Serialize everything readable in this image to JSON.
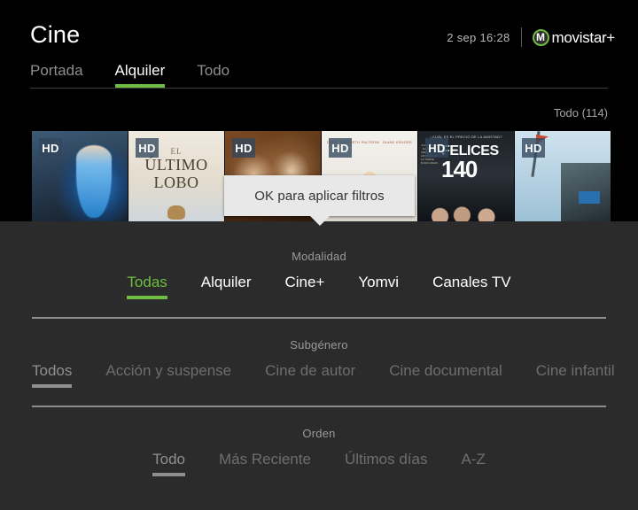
{
  "header": {
    "title": "Cine",
    "clock": "2 sep 16:28",
    "brand_mark": "M",
    "brand_text": "movistar+",
    "brand_icon": "movistar-logo-icon",
    "accent_color": "#6fbe44",
    "background_color": "#000000"
  },
  "tabs": [
    {
      "label": "Portada",
      "selected": false
    },
    {
      "label": "Alquiler",
      "selected": true
    },
    {
      "label": "Todo",
      "selected": false
    }
  ],
  "content": {
    "count_label": "Todo (114)",
    "posters": [
      {
        "badge": "HD",
        "title": "",
        "alt": "cinderella-poster"
      },
      {
        "badge": "HD",
        "title_line1": "EL",
        "title_line2": "ÚLTIMO",
        "title_line3": "LOBO",
        "alt": "el-ultimo-lobo-poster"
      },
      {
        "badge": "HD",
        "title": "",
        "alt": "sepia-drama-poster"
      },
      {
        "badge": "HD",
        "title": "",
        "credits": [
          "DEPP",
          "GWYNETH PALTROW",
          "DIANE KRUGER"
        ],
        "alt": "credits-poster"
      },
      {
        "badge": "HD",
        "tagline": "¿CUÁL ES EL PRECIO DE LA AMISTAD?",
        "title_line1": "FELICES",
        "title_line2": "140",
        "alt": "felices-140-poster"
      },
      {
        "badge": "HD",
        "title": "",
        "alt": "sky-truck-poster"
      }
    ]
  },
  "tooltip": {
    "text": "OK para aplicar filtros",
    "background_color": "#e8e8e8",
    "text_color": "#333333"
  },
  "filters": {
    "panel_background": "#2b2b2b",
    "sections": [
      {
        "id": "modalidad",
        "title": "Modalidad",
        "options": [
          {
            "label": "Todas",
            "selected": true
          },
          {
            "label": "Alquiler",
            "selected": false
          },
          {
            "label": "Cine+",
            "selected": false
          },
          {
            "label": "Yomvi",
            "selected": false
          },
          {
            "label": "Canales TV",
            "selected": false
          }
        ]
      },
      {
        "id": "subgenero",
        "title": "Subgénero",
        "options": [
          {
            "label": "Todos",
            "selected": true
          },
          {
            "label": "Acción y suspense",
            "selected": false
          },
          {
            "label": "Cine de autor",
            "selected": false
          },
          {
            "label": "Cine documental",
            "selected": false
          },
          {
            "label": "Cine infantil",
            "selected": false
          }
        ]
      },
      {
        "id": "orden",
        "title": "Orden",
        "options": [
          {
            "label": "Todo",
            "selected": true
          },
          {
            "label": "Más Reciente",
            "selected": false
          },
          {
            "label": "Últimos días",
            "selected": false
          },
          {
            "label": "A-Z",
            "selected": false
          }
        ]
      }
    ]
  }
}
